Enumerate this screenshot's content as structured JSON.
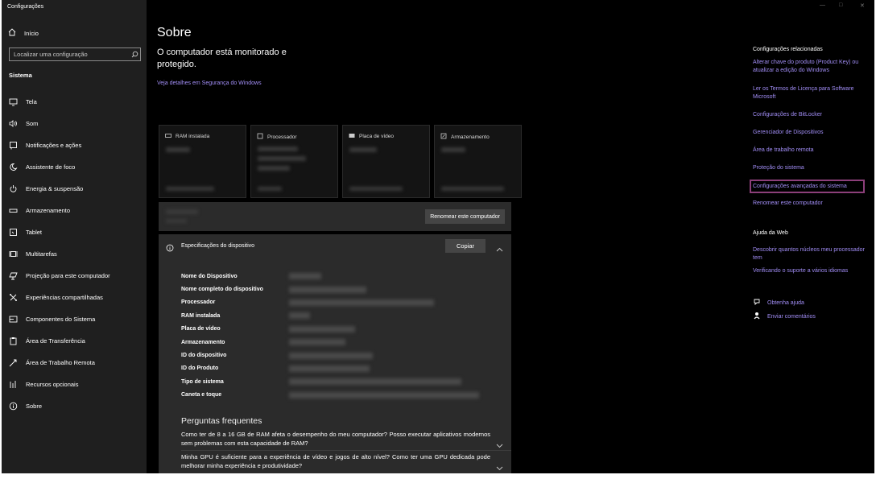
{
  "app": {
    "title": "Configurações"
  },
  "sidebar": {
    "home": "Início",
    "search_placeholder": "Localizar uma configuração",
    "section": "Sistema",
    "items": [
      {
        "label": "Tela",
        "icon": "monitor-icon"
      },
      {
        "label": "Som",
        "icon": "speaker-icon"
      },
      {
        "label": "Notificações e ações",
        "icon": "notifications-icon"
      },
      {
        "label": "Assistente de foco",
        "icon": "moon-icon"
      },
      {
        "label": "Energia & suspensão",
        "icon": "power-icon"
      },
      {
        "label": "Armazenamento",
        "icon": "storage-icon"
      },
      {
        "label": "Tablet",
        "icon": "tablet-icon"
      },
      {
        "label": "Multitarefas",
        "icon": "multitask-icon"
      },
      {
        "label": "Projeção para este computador",
        "icon": "projection-icon"
      },
      {
        "label": "Experiências compartilhadas",
        "icon": "shared-icon"
      },
      {
        "label": "Componentes do Sistema",
        "icon": "components-icon"
      },
      {
        "label": "Área de Transferência",
        "icon": "clipboard-icon"
      },
      {
        "label": "Área de Trabalho Remota",
        "icon": "remote-icon"
      },
      {
        "label": "Recursos opcionais",
        "icon": "features-icon"
      },
      {
        "label": "Sobre",
        "icon": "info-icon"
      }
    ]
  },
  "main": {
    "title": "Sobre",
    "protection": "O computador está monitorado e protegido.",
    "security_link": "Veja detalhes em Segurança do Windows",
    "cards": [
      {
        "label": "RAM instalada",
        "icon": "ram-icon"
      },
      {
        "label": "Processador",
        "icon": "cpu-icon"
      },
      {
        "label": "Placa de vídeo",
        "icon": "gpu-icon"
      },
      {
        "label": "Armazenamento",
        "icon": "disk-icon"
      }
    ],
    "rename_button": "Renomear este computador",
    "specs": {
      "title": "Especificações do dispositivo",
      "copy": "Copiar",
      "rows": [
        "Nome do Dispositivo",
        "Nome completo do dispositivo",
        "Processador",
        "RAM instalada",
        "Placa de vídeo",
        "Armazenamento",
        "ID do dispositivo",
        "ID do Produto",
        "Tipo de sistema",
        "Caneta e toque"
      ]
    },
    "faq": {
      "title": "Perguntas frequentes",
      "q1": "Como ter de 8 a 16 GB de RAM afeta o desempenho do meu computador? Posso executar aplicativos modernos sem problemas com esta capacidade de RAM?",
      "q2": "Minha GPU é suficiente para a experiência de vídeo e jogos de alto nível? Como ter uma GPU dedicada pode melhorar minha experiência e produtividade?"
    }
  },
  "rail": {
    "related_title": "Configurações relacionadas",
    "related": [
      "Alterar chave do produto (Product Key) ou atualizar a edição do Windows",
      "Ler os Termos de Licença para Software Microsoft",
      "Configurações de BitLocker",
      "Gerenciador de Dispositivos",
      "Área de trabalho remota",
      "Proteção do sistema",
      "Configurações avançadas do sistema",
      "Renomear este computador"
    ],
    "web_title": "Ajuda da Web",
    "web": [
      "Descobrir quantos núcleos meu processador tem",
      "Verificando o suporte a vários idiomas"
    ],
    "help": "Obtenha ajuda",
    "feedback": "Enviar comentários"
  },
  "colors": {
    "accent_link": "#a18df5",
    "highlight_border": "#8c3f7a"
  }
}
